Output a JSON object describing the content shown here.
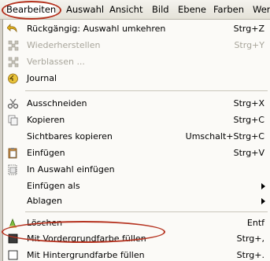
{
  "menubar": {
    "items": [
      {
        "label": "Bearbeiten"
      },
      {
        "label": "Auswahl"
      },
      {
        "label": "Ansicht"
      },
      {
        "label": "Bild"
      },
      {
        "label": "Ebene"
      },
      {
        "label": "Farben"
      },
      {
        "label": "Wer"
      }
    ]
  },
  "menu": {
    "items": [
      {
        "label": "Rückgängig: Auswahl umkehren",
        "shortcut": "Strg+Z",
        "icon": "undo-icon",
        "enabled": true
      },
      {
        "label": "Wiederherstellen",
        "shortcut": "Strg+Y",
        "icon": "redo-icon",
        "enabled": false
      },
      {
        "label": "Verblassen ...",
        "shortcut": "",
        "icon": "fade-icon",
        "enabled": false
      },
      {
        "label": "Journal",
        "shortcut": "",
        "icon": "journal-icon",
        "enabled": true
      },
      {
        "label": "Ausschneiden",
        "shortcut": "Strg+X",
        "icon": "scissors-icon",
        "enabled": true
      },
      {
        "label": "Kopieren",
        "shortcut": "Strg+C",
        "icon": "copy-icon",
        "enabled": true
      },
      {
        "label": "Sichtbares kopieren",
        "shortcut": "Umschalt+Strg+C",
        "icon": "",
        "enabled": true
      },
      {
        "label": "Einfügen",
        "shortcut": "Strg+V",
        "icon": "paste-icon",
        "enabled": true
      },
      {
        "label": "In Auswahl einfügen",
        "shortcut": "",
        "icon": "paste-into-icon",
        "enabled": true
      },
      {
        "label": "Einfügen als",
        "shortcut": "",
        "icon": "",
        "enabled": true,
        "submenu": true
      },
      {
        "label": "Ablagen",
        "shortcut": "",
        "icon": "",
        "enabled": true,
        "submenu": true
      },
      {
        "label": "Löschen",
        "shortcut": "Entf",
        "icon": "clear-icon",
        "enabled": true
      },
      {
        "label": "Mit Vordergrundfarbe füllen",
        "shortcut": "Strg+,",
        "icon": "fg-fill-icon",
        "enabled": true
      },
      {
        "label": "Mit Hintergrundfarbe füllen",
        "shortcut": "Strg+.",
        "icon": "bg-fill-icon",
        "enabled": true
      }
    ]
  },
  "colors": {
    "highlight_ellipse": "#b5321f",
    "foreground_swatch": "#3a3a3a",
    "background_swatch": "#ffffff"
  }
}
